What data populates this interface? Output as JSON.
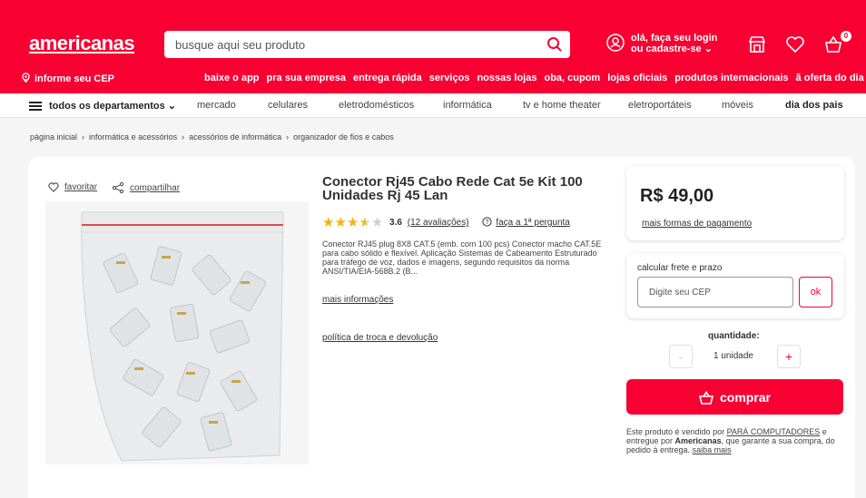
{
  "header": {
    "logo": "americanas",
    "search_placeholder": "busque aqui seu produto",
    "login_line1": "olá, faça seu login",
    "login_line2": "ou cadastre-se ⌄",
    "cart_count": "0",
    "cep_label": "informe seu CEP",
    "nav_links": [
      "baixe o app",
      "pra sua empresa",
      "entrega rápida",
      "serviços",
      "nossas lojas",
      "oba, cupom",
      "lojas oficiais",
      "produtos internacionais",
      "ã oferta do dia"
    ]
  },
  "categories": {
    "all_label": "todos os departamentos ⌄",
    "items": [
      "mercado",
      "celulares",
      "eletrodomésticos",
      "informática",
      "tv e home theater",
      "eletroportáteis",
      "móveis",
      "dia dos pais"
    ]
  },
  "breadcrumb": [
    "página inicial",
    "informática e acessórios",
    "acessórios de informática",
    "organizador de fios e cabos"
  ],
  "product": {
    "favorite_label": "favoritar",
    "share_label": "compartilhar",
    "title": "Conector Rj45 Cabo Rede Cat 5e Kit 100 Unidades Rj 45 Lan",
    "rating_value": "3.6",
    "rating_count_label": "(12 avaliações)",
    "question_label": "faça a 1ª pergunta",
    "description": "Conector RJ45 plug 8X8 CAT.5 (emb. com 100 pcs) Conector macho CAT.5E para cabo sólido e flexível. Aplicação Sistemas de Cabeamento Estruturado para tráfego de voz, dados e imagens, segundo requisitos da norma ANSI/TIA/EIA-568B.2 (B...",
    "more_info": "mais informações",
    "policy": "política de troca e devolução"
  },
  "purchase": {
    "price": "R$ 49,00",
    "payment_link": "mais formas de pagamento",
    "shipping_label": "calcular frete e prazo",
    "cep_placeholder": "Digite seu CEP",
    "ok_label": "ok",
    "quantity_label": "quantidade:",
    "quantity_value": "1 unidade",
    "minus": "-",
    "plus": "+",
    "buy_label": "comprar",
    "seller_pre": "Este produto é vendido por ",
    "seller_name": "PARÁ COMPUTADORES",
    "seller_mid": " e entregue por ",
    "seller_deliverer": "Americanas",
    "seller_post": ", que garante a sua compra, do pedido à entrega. ",
    "seller_more": "saiba mais"
  },
  "colors": {
    "brand": "#f80032",
    "star": "#f5b30a"
  }
}
